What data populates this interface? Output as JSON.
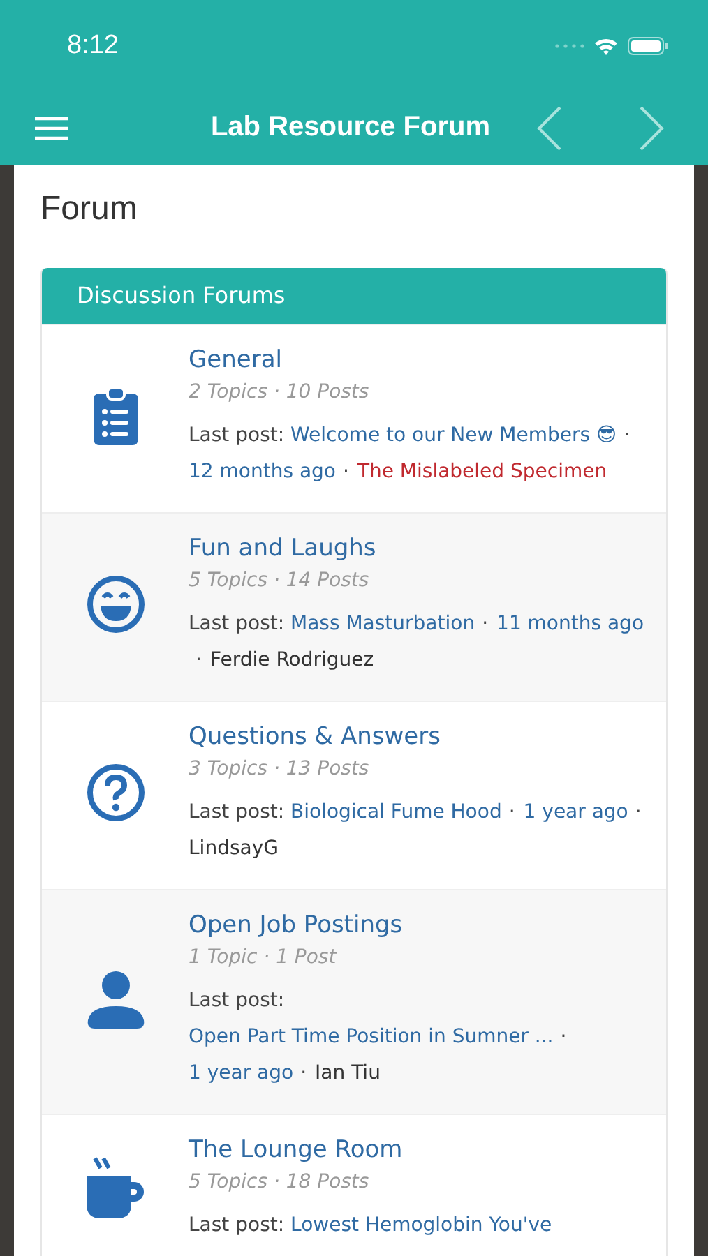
{
  "status_bar": {
    "time": "8:12"
  },
  "navbar": {
    "title": "Lab Resource Forum"
  },
  "page": {
    "title": "Forum"
  },
  "section": {
    "title": "Discussion Forums"
  },
  "forums": [
    {
      "name": "General",
      "stats": "2 Topics · 10 Posts",
      "last_post": {
        "label": "Last post:",
        "topic": "Welcome to our New Members 😎",
        "separator": "·",
        "time": "12 months ago",
        "author": "The Mislabeled Specimen",
        "color": "#c0292f"
      }
    },
    {
      "name": "Fun and Laughs",
      "stats": "5 Topics · 14 Posts",
      "last_post": {
        "label": "Last post:",
        "topic": "Mass Masturbation",
        "separator": "·",
        "time": "11 months ago",
        "author": "Ferdie Rodriguez",
        "color": "#333333"
      }
    },
    {
      "name": "Questions & Answers",
      "stats": "3 Topics · 13 Posts",
      "last_post": {
        "label": "Last post:",
        "topic": "Biological Fume Hood",
        "separator": "·",
        "time": "1 year ago",
        "author": "LindsayG",
        "color": "#333333"
      }
    },
    {
      "name": "Open Job Postings",
      "stats": "1 Topic · 1 Post",
      "last_post": {
        "label": "Last post:",
        "topic": "Open Part Time Position in Sumner ...",
        "separator": "·",
        "time": "1 year ago",
        "author": "Ian Tiu",
        "color": "#333333"
      }
    },
    {
      "name": "The Lounge Room",
      "stats": "5 Topics · 18 Posts",
      "last_post": {
        "label": "Last post:",
        "topic": "Lowest Hemoglobin You've"
      }
    }
  ]
}
